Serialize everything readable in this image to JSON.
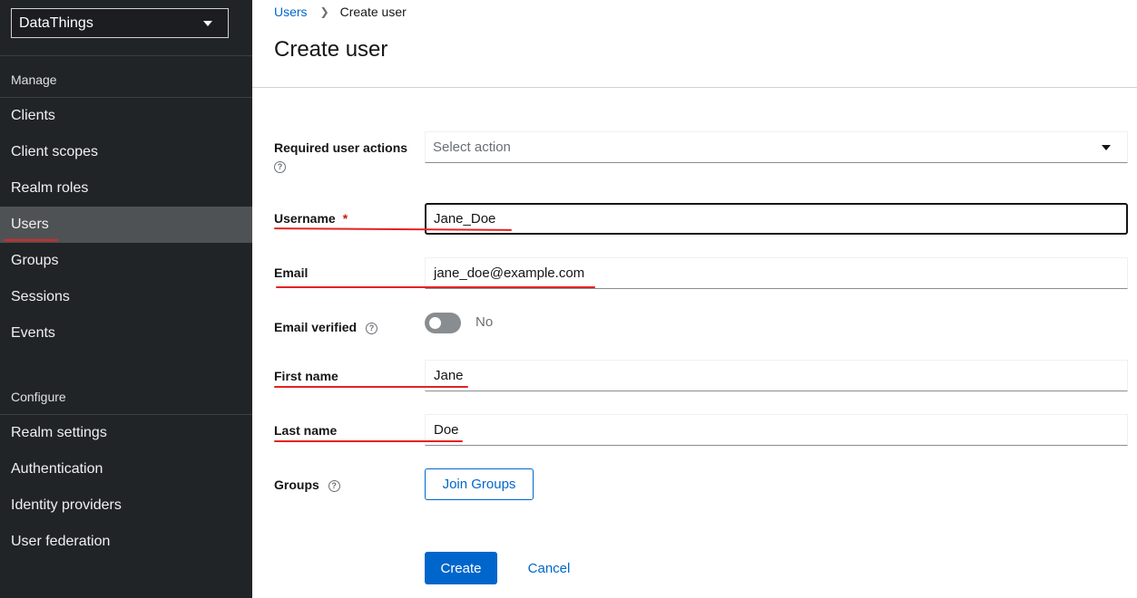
{
  "sidebar": {
    "realm": "DataThings",
    "manage_title": "Manage",
    "manage_items": [
      "Clients",
      "Client scopes",
      "Realm roles",
      "Users",
      "Groups",
      "Sessions",
      "Events"
    ],
    "configure_title": "Configure",
    "configure_items": [
      "Realm settings",
      "Authentication",
      "Identity providers",
      "User federation"
    ],
    "active_item": "Users"
  },
  "breadcrumb": {
    "parent": "Users",
    "current": "Create user"
  },
  "page_title": "Create user",
  "form": {
    "required_actions": {
      "label": "Required user actions",
      "placeholder": "Select action"
    },
    "username": {
      "label": "Username",
      "required_mark": "*",
      "value": "Jane_Doe"
    },
    "email": {
      "label": "Email",
      "value": "jane_doe@example.com"
    },
    "email_verified": {
      "label": "Email verified",
      "state": "No"
    },
    "first_name": {
      "label": "First name",
      "value": "Jane"
    },
    "last_name": {
      "label": "Last name",
      "value": "Doe"
    },
    "groups": {
      "label": "Groups",
      "button": "Join Groups"
    }
  },
  "actions": {
    "create": "Create",
    "cancel": "Cancel"
  },
  "icons": {
    "help": "?"
  },
  "colors": {
    "sidebar_bg": "#212427",
    "active_nav_bg": "#4f5255",
    "primary": "#0066cc",
    "annotation_red": "#e52222"
  }
}
